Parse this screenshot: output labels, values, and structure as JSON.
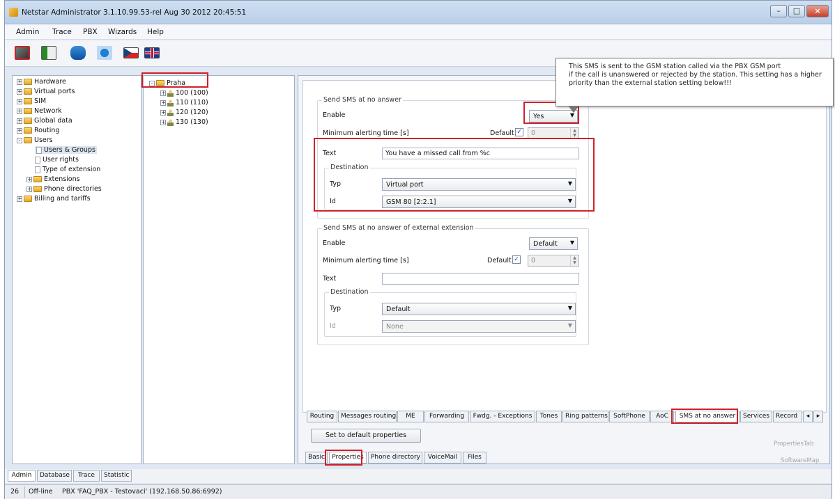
{
  "window": {
    "title": "Netstar Administrator 3.1.10.99.53-rel Aug 30 2012 20:45:51"
  },
  "menu": [
    "Admin",
    "Trace",
    "PBX",
    "Wizards",
    "Help"
  ],
  "toolbar_icons": [
    "disconnect-icon",
    "connect-flag-icon",
    "database-icon",
    "refresh-icon",
    "czech-flag-icon",
    "uk-flag-icon"
  ],
  "nav_tree": [
    {
      "label": "Hardware",
      "expander": "+"
    },
    {
      "label": "Virtual ports",
      "expander": "+"
    },
    {
      "label": "SIM",
      "expander": "+"
    },
    {
      "label": "Network",
      "expander": "+"
    },
    {
      "label": "Global data",
      "expander": "+"
    },
    {
      "label": "Routing",
      "expander": "+"
    },
    {
      "label": "Users",
      "expander": "-"
    },
    {
      "label": "Users & Groups"
    },
    {
      "label": "User rights"
    },
    {
      "label": "Type of extension"
    },
    {
      "label": "Extensions",
      "expander": "+"
    },
    {
      "label": "Phone directories",
      "expander": "+"
    },
    {
      "label": "Billing and tariffs",
      "expander": "+"
    }
  ],
  "pbx_tree": {
    "root": "Praha",
    "items": [
      "100 (100)",
      "110 (110)",
      "120 (120)",
      "130 (130)"
    ]
  },
  "tooltip": {
    "line1": "This SMS is sent to the GSM station called via the PBX GSM port",
    "line2": "if the call is unanswered or rejected by the station. This setting has a higher",
    "line3": "priority than the external station setting below!!!"
  },
  "sms_no_answer": {
    "group_title": "Send SMS at no answer",
    "enable_label": "Enable",
    "enable_value": "Yes",
    "min_alert_label": "Minimum alerting time [s]",
    "default_label": "Default",
    "default_checked": "✓",
    "min_alert_value": "0",
    "text_label": "Text",
    "text_value": "You have a missed call from %c",
    "destination_title": "Destination",
    "typ_label": "Typ",
    "typ_value": "Virtual port",
    "id_label": "Id",
    "id_value": "GSM 80 [2:2.1]"
  },
  "sms_external": {
    "group_title": "Send SMS at no answer of external extension",
    "enable_label": "Enable",
    "enable_value": "Default",
    "min_alert_label": "Minimum alerting time [s]",
    "default_label": "Default",
    "default_checked": "✓",
    "min_alert_value": "0",
    "text_label": "Text",
    "text_value": "",
    "destination_title": "Destination",
    "typ_label": "Typ",
    "typ_value": "Default",
    "id_label": "Id",
    "id_value": "None"
  },
  "property_tabs": [
    "Routing",
    "Messages routing",
    "ME",
    "Forwarding",
    "Fwdg. - Exceptions",
    "Tones",
    "Ring patterns",
    "SoftPhone",
    "AoC",
    "SMS at no answer",
    "Services",
    "Record"
  ],
  "active_property_tab": "SMS at no answer",
  "set_default_button": "Set to default properties",
  "main_tabs": [
    "Basic",
    "Properties",
    "Phone directory",
    "VoiceMail",
    "Files"
  ],
  "active_main_tab": "Properties",
  "corner_labels": {
    "upper": "PropertiesTab",
    "lower": "SoftwareMap"
  },
  "bottom_tabs": [
    "Admin",
    "Database",
    "Trace",
    "Statistic"
  ],
  "active_bottom_tab": "Admin",
  "status": {
    "count": "26",
    "state": "Off-line",
    "pbx": "PBX 'FAQ_PBX - Testovaci' (192.168.50.86:6992)"
  },
  "colors": {
    "highlight": "#d0202a",
    "titlebar": "#b9cfe8"
  }
}
